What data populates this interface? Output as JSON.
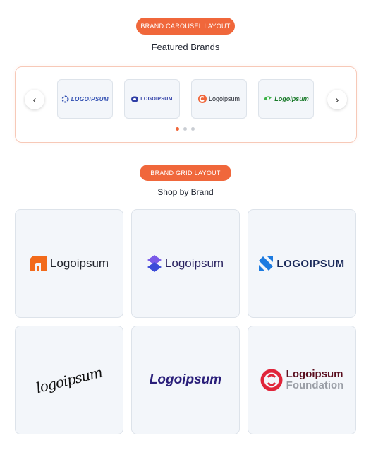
{
  "carousel_section": {
    "badge": "BRAND CAROUSEL LAYOUT",
    "title": "Featured Brands",
    "prev_icon": "chevron-left-icon",
    "next_icon": "chevron-right-icon",
    "brands": [
      {
        "name": "LOGOIPSUM",
        "color": "#3351b3"
      },
      {
        "name": "LOGOIPSUM",
        "color": "#2f3ea6"
      },
      {
        "name": "Logoipsum",
        "color": "#f0673b"
      },
      {
        "name": "Logoipsum",
        "color": "#1a7a2a"
      }
    ],
    "pagination": {
      "pages": 3,
      "active": 1
    }
  },
  "grid_section": {
    "badge": "BRAND GRID LAYOUT",
    "title": "Shop by Brand",
    "brands": [
      {
        "name": "Logoipsum",
        "color": "#f26a1b"
      },
      {
        "name": "Logoipsum",
        "color": "#3b4bd8"
      },
      {
        "name": "LOGOIPSUM",
        "color": "#1d7be0"
      },
      {
        "name": "logoipsum",
        "color": "#111111"
      },
      {
        "name": "Logoipsum",
        "color": "#2a1f7a"
      },
      {
        "name": "Logoipsum",
        "name_line2": "Foundation",
        "color": "#e0253a"
      }
    ]
  },
  "colors": {
    "accent": "#f0673b",
    "card_bg": "#f3f6fa",
    "card_border": "#dde3ea"
  }
}
